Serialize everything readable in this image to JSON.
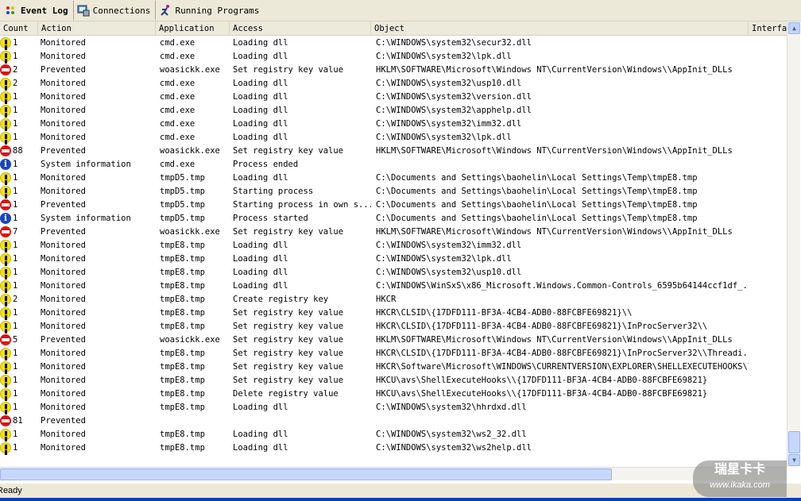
{
  "tabs": [
    {
      "label": "Event Log",
      "icon": "event-log-icon"
    },
    {
      "label": "Connections",
      "icon": "connections-icon"
    },
    {
      "label": "Running Programs",
      "icon": "running-programs-icon"
    }
  ],
  "columns": [
    "Count",
    "Action",
    "Application",
    "Access",
    "Object",
    "Interfa"
  ],
  "rows": [
    {
      "type": "warn",
      "count": "1",
      "action": "Monitored",
      "app": "cmd.exe",
      "access": "Loading dll",
      "object": "C:\\WINDOWS\\system32\\secur32.dll"
    },
    {
      "type": "warn",
      "count": "1",
      "action": "Monitored",
      "app": "cmd.exe",
      "access": "Loading dll",
      "object": "C:\\WINDOWS\\system32\\lpk.dll"
    },
    {
      "type": "stop",
      "count": "2",
      "action": "Prevented",
      "app": "woasickk.exe",
      "access": "Set registry key value",
      "object": "HKLM\\SOFTWARE\\Microsoft\\Windows NT\\CurrentVersion\\Windows\\\\AppInit_DLLs"
    },
    {
      "type": "warn",
      "count": "2",
      "action": "Monitored",
      "app": "cmd.exe",
      "access": "Loading dll",
      "object": "C:\\WINDOWS\\system32\\usp10.dll"
    },
    {
      "type": "warn",
      "count": "1",
      "action": "Monitored",
      "app": "cmd.exe",
      "access": "Loading dll",
      "object": "C:\\WINDOWS\\system32\\version.dll"
    },
    {
      "type": "warn",
      "count": "1",
      "action": "Monitored",
      "app": "cmd.exe",
      "access": "Loading dll",
      "object": "C:\\WINDOWS\\system32\\apphelp.dll"
    },
    {
      "type": "warn",
      "count": "1",
      "action": "Monitored",
      "app": "cmd.exe",
      "access": "Loading dll",
      "object": "C:\\WINDOWS\\system32\\imm32.dll"
    },
    {
      "type": "warn",
      "count": "1",
      "action": "Monitored",
      "app": "cmd.exe",
      "access": "Loading dll",
      "object": "C:\\WINDOWS\\system32\\lpk.dll"
    },
    {
      "type": "stop",
      "count": "88",
      "action": "Prevented",
      "app": "woasickk.exe",
      "access": "Set registry key value",
      "object": "HKLM\\SOFTWARE\\Microsoft\\Windows NT\\CurrentVersion\\Windows\\\\AppInit_DLLs"
    },
    {
      "type": "info",
      "count": "1",
      "action": "System information",
      "app": "cmd.exe",
      "access": "Process ended",
      "object": ""
    },
    {
      "type": "warn",
      "count": "1",
      "action": "Monitored",
      "app": "tmpD5.tmp",
      "access": "Loading dll",
      "object": "C:\\Documents and Settings\\baohelin\\Local Settings\\Temp\\tmpE8.tmp"
    },
    {
      "type": "warn",
      "count": "1",
      "action": "Monitored",
      "app": "tmpD5.tmp",
      "access": "Starting process",
      "object": "C:\\Documents and Settings\\baohelin\\Local Settings\\Temp\\tmpE8.tmp"
    },
    {
      "type": "stop",
      "count": "1",
      "action": "Prevented",
      "app": "tmpD5.tmp",
      "access": "Starting process in own s...",
      "object": "C:\\Documents and Settings\\baohelin\\Local Settings\\Temp\\tmpE8.tmp"
    },
    {
      "type": "info",
      "count": "1",
      "action": "System information",
      "app": "tmpD5.tmp",
      "access": "Process started",
      "object": "C:\\Documents and Settings\\baohelin\\Local Settings\\Temp\\tmpE8.tmp"
    },
    {
      "type": "stop",
      "count": "7",
      "action": "Prevented",
      "app": "woasickk.exe",
      "access": "Set registry key value",
      "object": "HKLM\\SOFTWARE\\Microsoft\\Windows NT\\CurrentVersion\\Windows\\\\AppInit_DLLs"
    },
    {
      "type": "warn",
      "count": "1",
      "action": "Monitored",
      "app": "tmpE8.tmp",
      "access": "Loading dll",
      "object": "C:\\WINDOWS\\system32\\imm32.dll"
    },
    {
      "type": "warn",
      "count": "1",
      "action": "Monitored",
      "app": "tmpE8.tmp",
      "access": "Loading dll",
      "object": "C:\\WINDOWS\\system32\\lpk.dll"
    },
    {
      "type": "warn",
      "count": "1",
      "action": "Monitored",
      "app": "tmpE8.tmp",
      "access": "Loading dll",
      "object": "C:\\WINDOWS\\system32\\usp10.dll"
    },
    {
      "type": "warn",
      "count": "1",
      "action": "Monitored",
      "app": "tmpE8.tmp",
      "access": "Loading dll",
      "object": "C:\\WINDOWS\\WinSxS\\x86_Microsoft.Windows.Common-Controls_6595b64144ccf1df_..."
    },
    {
      "type": "warn",
      "count": "2",
      "action": "Monitored",
      "app": "tmpE8.tmp",
      "access": "Create registry key",
      "object": "HKCR"
    },
    {
      "type": "warn",
      "count": "1",
      "action": "Monitored",
      "app": "tmpE8.tmp",
      "access": "Set registry key value",
      "object": "HKCR\\CLSID\\{17DFD111-BF3A-4CB4-ADB0-88FCBFE69821}\\\\"
    },
    {
      "type": "warn",
      "count": "1",
      "action": "Monitored",
      "app": "tmpE8.tmp",
      "access": "Set registry key value",
      "object": "HKCR\\CLSID\\{17DFD111-BF3A-4CB4-ADB0-88FCBFE69821}\\InProcServer32\\\\"
    },
    {
      "type": "stop",
      "count": "5",
      "action": "Prevented",
      "app": "woasickk.exe",
      "access": "Set registry key value",
      "object": "HKLM\\SOFTWARE\\Microsoft\\Windows NT\\CurrentVersion\\Windows\\\\AppInit_DLLs"
    },
    {
      "type": "warn",
      "count": "1",
      "action": "Monitored",
      "app": "tmpE8.tmp",
      "access": "Set registry key value",
      "object": "HKCR\\CLSID\\{17DFD111-BF3A-4CB4-ADB0-88FCBFE69821}\\InProcServer32\\\\Threadi..."
    },
    {
      "type": "warn",
      "count": "1",
      "action": "Monitored",
      "app": "tmpE8.tmp",
      "access": "Set registry key value",
      "object": "HKCR\\Software\\Microsoft\\WINDOWS\\CURRENTVERSION\\EXPLORER\\SHELLEXECUTEHOOKS\\\\"
    },
    {
      "type": "warn",
      "count": "1",
      "action": "Monitored",
      "app": "tmpE8.tmp",
      "access": "Set registry key value",
      "object": "HKCU\\avs\\ShellExecuteHooks\\\\{17DFD111-BF3A-4CB4-ADB0-88FCBFE69821}"
    },
    {
      "type": "warn",
      "count": "1",
      "action": "Monitored",
      "app": "tmpE8.tmp",
      "access": "Delete registry value",
      "object": "HKCU\\avs\\ShellExecuteHooks\\\\{17DFD111-BF3A-4CB4-ADB0-88FCBFE69821}"
    },
    {
      "type": "warn",
      "count": "1",
      "action": "Monitored",
      "app": "tmpE8.tmp",
      "access": "Loading dll",
      "object": "C:\\WINDOWS\\system32\\hhrdxd.dll"
    },
    {
      "type": "stop",
      "count": "81",
      "action": "Prevented",
      "app": "",
      "access": "",
      "object": ""
    },
    {
      "type": "warn",
      "count": "1",
      "action": "Monitored",
      "app": "tmpE8.tmp",
      "access": "Loading dll",
      "object": "C:\\WINDOWS\\system32\\ws2_32.dll"
    },
    {
      "type": "warn",
      "count": "1",
      "action": "Monitored",
      "app": "tmpE8.tmp",
      "access": "Loading dll",
      "object": "C:\\WINDOWS\\system32\\ws2help.dll"
    }
  ],
  "status": "Ready",
  "watermark": {
    "line1": "瑞星卡卡",
    "line2": "www.ikaka.com"
  }
}
